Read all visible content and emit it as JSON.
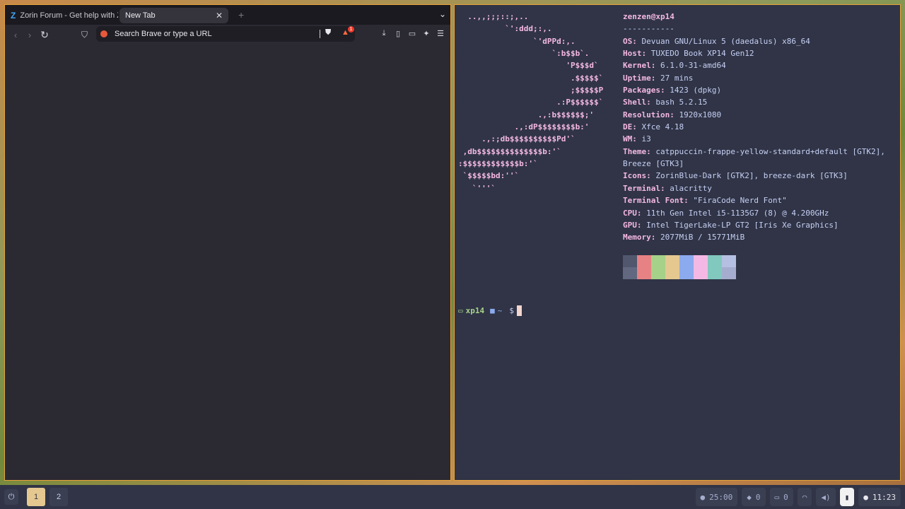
{
  "browser": {
    "tabs": [
      {
        "label": "Zorin Forum - Get help with Zorin OS"
      },
      {
        "label": "New Tab"
      }
    ],
    "url_placeholder": "Search Brave or type a URL",
    "rewards_badge": "1"
  },
  "terminal": {
    "ascii_art": "  ..,,;;;::;,..\n          `':ddd;:,.\n                `'dPPd:,.\n                    `:b$$b`.\n                       'P$$$d`\n                        .$$$$$`\n                        ;$$$$$P\n                     .:P$$$$$$`\n                 .,:b$$$$$$;'\n            .,:dP$$$$$$$$b:'\n     .,:;db$$$$$$$$$$Pd'`\n ,db$$$$$$$$$$$$$$b:'`\n:$$$$$$$$$$$$b:'`\n `$$$$$bd:''`\n   `'''`",
    "user_host": "zenzen@xp14",
    "separator": "-----------",
    "info": [
      {
        "key": "OS",
        "value": "Devuan GNU/Linux 5 (daedalus) x86_64"
      },
      {
        "key": "Host",
        "value": "TUXEDO Book XP14 Gen12"
      },
      {
        "key": "Kernel",
        "value": "6.1.0-31-amd64"
      },
      {
        "key": "Uptime",
        "value": "27 mins"
      },
      {
        "key": "Packages",
        "value": "1423 (dpkg)"
      },
      {
        "key": "Shell",
        "value": "bash 5.2.15"
      },
      {
        "key": "Resolution",
        "value": "1920x1080"
      },
      {
        "key": "DE",
        "value": "Xfce 4.18"
      },
      {
        "key": "WM",
        "value": "i3"
      },
      {
        "key": "Theme",
        "value": "catppuccin-frappe-yellow-standard+default [GTK2], Breeze [GTK3]"
      },
      {
        "key": "Icons",
        "value": "ZorinBlue-Dark [GTK2], breeze-dark [GTK3]"
      },
      {
        "key": "Terminal",
        "value": "alacritty"
      },
      {
        "key": "Terminal Font",
        "value": "\"FiraCode Nerd Font\""
      },
      {
        "key": "CPU",
        "value": "11th Gen Intel i5-1135G7 (8) @ 4.200GHz"
      },
      {
        "key": "GPU",
        "value": "Intel TigerLake-LP GT2 [Iris Xe Graphics]"
      },
      {
        "key": "Memory",
        "value": "2077MiB / 15771MiB"
      }
    ],
    "palette": [
      [
        "#51576d",
        "#626880"
      ],
      [
        "#e78284",
        "#e78284"
      ],
      [
        "#a6d189",
        "#a6d189"
      ],
      [
        "#e5c890",
        "#e5c890"
      ],
      [
        "#8caaee",
        "#8caaee"
      ],
      [
        "#f4b8e4",
        "#f4b8e4"
      ],
      [
        "#81c8be",
        "#81c8be"
      ],
      [
        "#b5bfe2",
        "#a5adce"
      ]
    ],
    "prompt": {
      "host": "xp14",
      "dir": "~",
      "symbol": "$"
    }
  },
  "bar": {
    "workspaces": [
      "1",
      "2"
    ],
    "pomodoro": "25:00",
    "docker": "0",
    "displays": "0",
    "clock": "11:23"
  }
}
